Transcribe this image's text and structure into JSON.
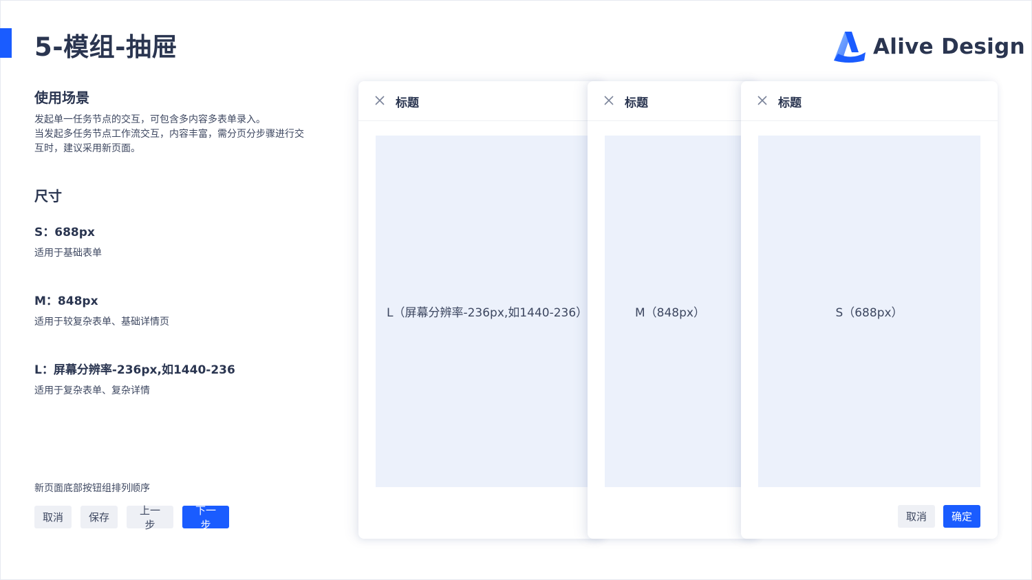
{
  "page": {
    "title": "5-模组-抽屉"
  },
  "logo": {
    "text": "Alive Design",
    "icon": "alive-logo-icon",
    "colors": [
      "#6ea8ff",
      "#1a5cff"
    ]
  },
  "usage": {
    "heading": "使用场景",
    "lines": [
      "发起单一任务节点的交互，可包含多内容多表单录入。",
      "当发起多任务节点工作流交互，内容丰富，需分页分步骤进行交",
      "互时，建议采用新页面。"
    ]
  },
  "sizes": {
    "heading": "尺寸",
    "items": [
      {
        "title": "S：688px",
        "desc": "适用于基础表单"
      },
      {
        "title": "M：848px",
        "desc": "适用于较复杂表单、基础详情页"
      },
      {
        "title": "L：屏幕分辨率-236px,如1440-236",
        "desc": "适用于复杂表单、复杂详情"
      }
    ]
  },
  "page_buttons": {
    "caption": "新页面底部按钮组排列顺序",
    "cancel": "取消",
    "save": "保存",
    "prev": "上一步",
    "next": "下一步"
  },
  "drawers": [
    {
      "title": "标题",
      "body": "L（屏幕分辨率-236px,如1440-236）"
    },
    {
      "title": "标题",
      "body": "M（848px）"
    },
    {
      "title": "标题",
      "body": "S（688px）",
      "cancel": "取消",
      "confirm": "确定"
    }
  ],
  "colors": {
    "primary": "#1a5cff",
    "placeholder": "#ecf1fb",
    "text": "#2a3550"
  }
}
